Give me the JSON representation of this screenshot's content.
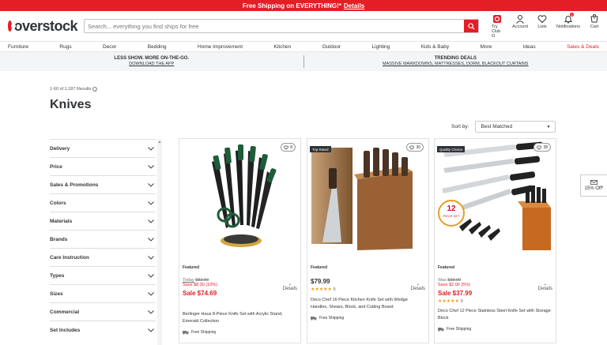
{
  "promo": {
    "text": "Free Shipping on EVERYTHING!*",
    "link": "Details"
  },
  "header": {
    "logo": "overstock",
    "search_placeholder": "Search... everything you find ships for free",
    "icons": [
      {
        "label": "Try Club O",
        "icon": "club-o-icon"
      },
      {
        "label": "Account",
        "icon": "account-icon"
      },
      {
        "label": "Lists",
        "icon": "heart-icon"
      },
      {
        "label": "Notifications",
        "icon": "bell-icon"
      },
      {
        "label": "Cart",
        "icon": "cart-icon",
        "count": "0"
      }
    ],
    "notification_count": "1"
  },
  "nav": [
    "Furniture",
    "Rugs",
    "Decor",
    "Bedding",
    "Home Improvement",
    "Kitchen",
    "Outdoor",
    "Lighting",
    "Kids & Baby",
    "More",
    "Ideas",
    "Sales & Deals"
  ],
  "banner": {
    "left_title": "LESS SHOW. MORE ON-THE-GO.",
    "left_link": "DOWNLOAD THE APP",
    "right_title": "TRENDING DEALS",
    "right_links": "MASSIVE MARKDOWNS, MATTRESSES, DORM, BLACKOUT CURTAINS"
  },
  "results": "1-60 of 1,187 Results",
  "page_title": "Knives",
  "sort": {
    "label": "Sort by:",
    "value": "Best Matched"
  },
  "filters": [
    "Delivery",
    "Price",
    "Sales & Promotions",
    "Colors",
    "Materials",
    "Brands",
    "Care Instruction",
    "Types",
    "Sizes",
    "Commercial",
    "Set Includes"
  ],
  "products": [
    {
      "tag": "",
      "hearts": "8",
      "featured": "Featured",
      "was_label": "Today",
      "was_price": "$82.99",
      "save": "Save $8.30 (10%)",
      "price": "Sale $74.69",
      "rating": "",
      "reviews": "",
      "name": "Berlinger Haus 8-Piece Knife Set with Acrylic Stand, Emerald Collection",
      "shipping": "Free Shipping",
      "details": "Details"
    },
    {
      "tag": "Top Rated",
      "hearts": "30",
      "featured": "Featured",
      "was_label": "",
      "was_price": "",
      "save": "",
      "price": "$79.99",
      "rating": "★★★★★",
      "reviews": "5",
      "name": "Deco Chef 16 Piece Kitchen Knife Set with Wedge Handles, Shears, Block, and Cutting Board",
      "shipping": "Free Shipping",
      "details": "Details"
    },
    {
      "tag": "Quality Choice",
      "hearts": "38",
      "featured": "Featured",
      "was_label": "Was",
      "was_price": "$39.99",
      "save": "Save $2.00 (5%)",
      "price": "Sale $37.99",
      "rating": "★★★★★",
      "reviews": "9",
      "name": "Deco Chef 12 Piece Stainless Steel Knife Set with Storage Block",
      "shipping": "Free Shipping",
      "details": "Details",
      "badge": "12 PIECE SET"
    }
  ],
  "side_promo": "15% Off*",
  "colors": {
    "brand": "#e31e24",
    "text": "#2f3337"
  }
}
